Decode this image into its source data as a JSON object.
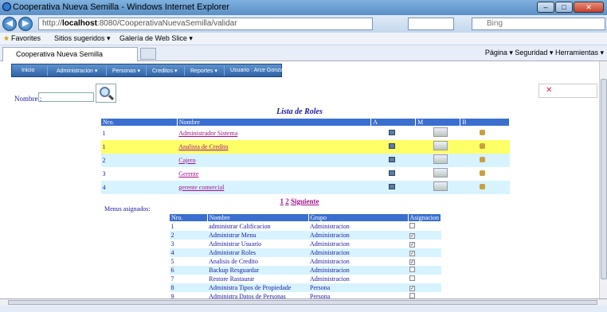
{
  "window": {
    "title": "Cooperativa Nueva Semilla - Windows Internet Explorer"
  },
  "address": {
    "url_prefix": "http://",
    "url_host": "localhost",
    "url_rest": ":8080/CooperativaNuevaSemilla/validar",
    "search_placeholder": "Bing"
  },
  "favorites": {
    "label": "Favorites",
    "suggested": "Sitios sugeridos ▾",
    "gallery": "Galería de Web Slice ▾"
  },
  "tab": {
    "title": "Cooperativa Nueva Semilla"
  },
  "commandbar": {
    "text": "Página ▾   Seguridad ▾   Herramientas ▾"
  },
  "menu": {
    "items": [
      "Inicio",
      "Administracion ▾",
      "Personas ▾",
      "Creditos ▾",
      "Reportes ▾",
      "Usuario : Arce Gonzalez Ana"
    ]
  },
  "search": {
    "label": "Nombre :"
  },
  "roles": {
    "title": "Lista de Roles",
    "headers": [
      "Nro.",
      "Nombre",
      "A",
      "M",
      "B"
    ],
    "rows": [
      {
        "nro": "1",
        "nombre": "Administrador Sistema",
        "style": "r0"
      },
      {
        "nro": "1",
        "nombre": "Analista de Credito",
        "style": "r1"
      },
      {
        "nro": "2",
        "nombre": "Cajero",
        "style": "r2"
      },
      {
        "nro": "3",
        "nombre": "Gerente",
        "style": "r0"
      },
      {
        "nro": "4",
        "nombre": "gerente comercial",
        "style": "r2"
      }
    ]
  },
  "pager": {
    "page1": "1",
    "page2": "2",
    "next": "Siguiente"
  },
  "menus": {
    "label": "Menus asignados:",
    "headers": [
      "Nro.",
      "Nombre",
      "Grupo",
      "Asignacion"
    ],
    "rows": [
      {
        "nro": "1",
        "nombre": "administrar Calificacion",
        "grupo": "Administracion",
        "checked": false
      },
      {
        "nro": "2",
        "nombre": "Administrar Menu",
        "grupo": "Administracion",
        "checked": true
      },
      {
        "nro": "3",
        "nombre": "Administrar Usuario",
        "grupo": "Administracion",
        "checked": true
      },
      {
        "nro": "4",
        "nombre": "Administrar Roles",
        "grupo": "Administracion",
        "checked": true
      },
      {
        "nro": "5",
        "nombre": "Analisis de Credito",
        "grupo": "Administracion",
        "checked": true
      },
      {
        "nro": "6",
        "nombre": "Backup Resguardar",
        "grupo": "Administracion",
        "checked": false
      },
      {
        "nro": "7",
        "nombre": "Restore Rastaurar",
        "grupo": "Administracion",
        "checked": false
      },
      {
        "nro": "8",
        "nombre": "Administra Tipos de Propiedade",
        "grupo": "Persona",
        "checked": true
      },
      {
        "nro": "9",
        "nombre": "Administra Datos de Personas",
        "grupo": "Persona",
        "checked": false
      }
    ]
  }
}
